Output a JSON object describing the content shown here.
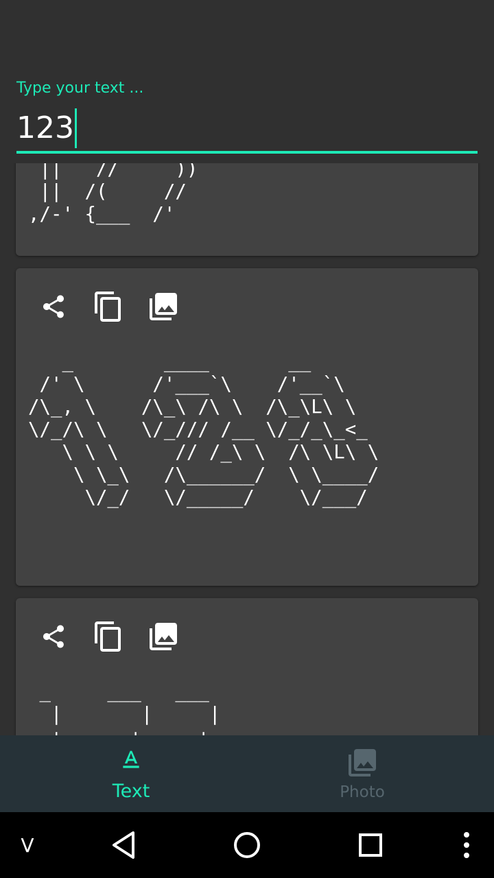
{
  "input": {
    "label": "Type your text ...",
    "value": "123"
  },
  "cards": [
    {
      "art": " ||   //     ))\n ||  /(     //\n,/-' {___  /'"
    },
    {
      "actions": [
        "share-icon",
        "copy-icon",
        "save-image-icon"
      ],
      "art": "   _        ____       __\n /' \\      /'___`\\    /'__`\\\n/\\_, \\    /\\_\\ /\\ \\  /\\_\\L\\ \\\n\\/_/\\ \\   \\/_/// /__ \\/_/_\\_<_\n   \\ \\ \\     // /_\\ \\  /\\ \\L\\ \\\n    \\ \\_\\   /\\______/  \\ \\____/\n     \\/_/   \\/_____/    \\/___/"
    },
    {
      "actions": [
        "share-icon",
        "copy-icon",
        "save-image-icon"
      ],
      "art": " _     ___   ___\n  |       |     |\n  +     -+-   -+-"
    }
  ],
  "bottom_nav": {
    "items": [
      {
        "label": "Text",
        "icon": "text-format-icon",
        "active": true
      },
      {
        "label": "Photo",
        "icon": "photo-library-icon",
        "active": false
      }
    ],
    "active_color": "#1de9b6",
    "inactive_color": "#56666e"
  },
  "system_nav": {
    "left_label": "V"
  }
}
